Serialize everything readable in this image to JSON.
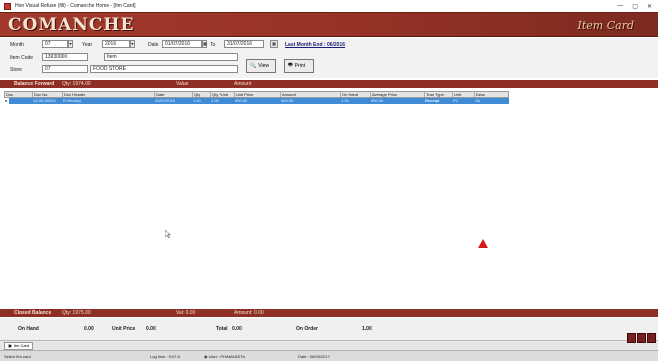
{
  "window": {
    "title": "Hon Visual Refuse (fill) - Comanche Home - [Itm Card]",
    "controls": [
      "—",
      "▢",
      "✕"
    ]
  },
  "banner": {
    "logo": "COMANCHE",
    "screen_title": "Item Card"
  },
  "form": {
    "month_label": "Month",
    "month_value": "07",
    "year_label": "Year",
    "year_value": "2016",
    "date_label": "Date",
    "date_from": "01/07/2016",
    "to_label": "To",
    "date_to": "31/07/2016",
    "last_month_link": "Last Month End : 06/2016",
    "item_code_label": "Item Code",
    "item_code_value": "13930000",
    "item_name_value": "Item",
    "store_label": "Store",
    "store_code_value": "07",
    "store_name_value": "FOOD STORE",
    "view_button": "View",
    "print_button": "Print"
  },
  "balance_forward": {
    "title": "Balance Forward",
    "qty": "Qty: 1974.00",
    "value": "Value",
    "amount": "Amount"
  },
  "grid": {
    "columns": [
      "Doc",
      "Doc No.",
      "Doc Header",
      "Date",
      "Qty",
      "Qty *Unit",
      "Unit Price",
      "Amount",
      "On Hand",
      "Average Price",
      "Tran Type",
      "Unit",
      "Desc"
    ],
    "rows": [
      [
        "▸",
        "13-00-00010",
        "R-Receipt",
        "25/07/2016",
        "1.00",
        "1.00",
        "900.00",
        "900.00",
        "1.00",
        "900.00",
        "Receipt",
        "PC",
        "Ok"
      ]
    ]
  },
  "closed_balance": {
    "title": "Closed Balance",
    "qty": "Qty: 1975.00",
    "value": "Val: 0.00",
    "amount": "Amount: 0.00"
  },
  "totals": {
    "on_hand_label": "On Hand",
    "on_hand_value": "0.00",
    "unit_price_label": "Unit Price",
    "unit_price_value": "0.00",
    "total_label": "Total",
    "total_value": "0.00",
    "on_order_label": "On Order",
    "on_order_value": "1.00"
  },
  "taskbar": {
    "active_task": "Itm Card"
  },
  "status": {
    "left": "Select Itm card",
    "log_time": "Log time : 9:07 A",
    "user": "User : PHAMANSTA",
    "date": "Date : 06/09/2017"
  },
  "colors": {
    "banner": "#9a3427",
    "section": "#8d2f24",
    "selection": "#3f8bd6"
  }
}
